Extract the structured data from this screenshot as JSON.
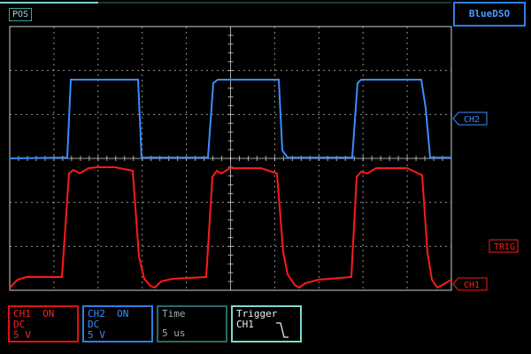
{
  "app": {
    "brand": "BlueDSO",
    "pos_label": "POS",
    "position_progress": 0.185
  },
  "markers": {
    "ch2": "CH2",
    "ch1": "CH1",
    "trig": "TRIG"
  },
  "colors": {
    "ch1": "#ff1a1a",
    "ch2": "#3a8cff",
    "grid": "#cfcfcf",
    "accent": "#2f7fe0"
  },
  "panels": {
    "ch1": {
      "name": "CH1",
      "state": "ON",
      "coupling": "DC",
      "scale": "5 V"
    },
    "ch2": {
      "name": "CH2",
      "state": "ON",
      "coupling": "DC",
      "scale": "5 V"
    },
    "time": {
      "label": "Time",
      "value": "5 us"
    },
    "trigger": {
      "label": "Trigger",
      "source": "CH1",
      "slope_icon": "falling-edge-icon"
    }
  }
}
